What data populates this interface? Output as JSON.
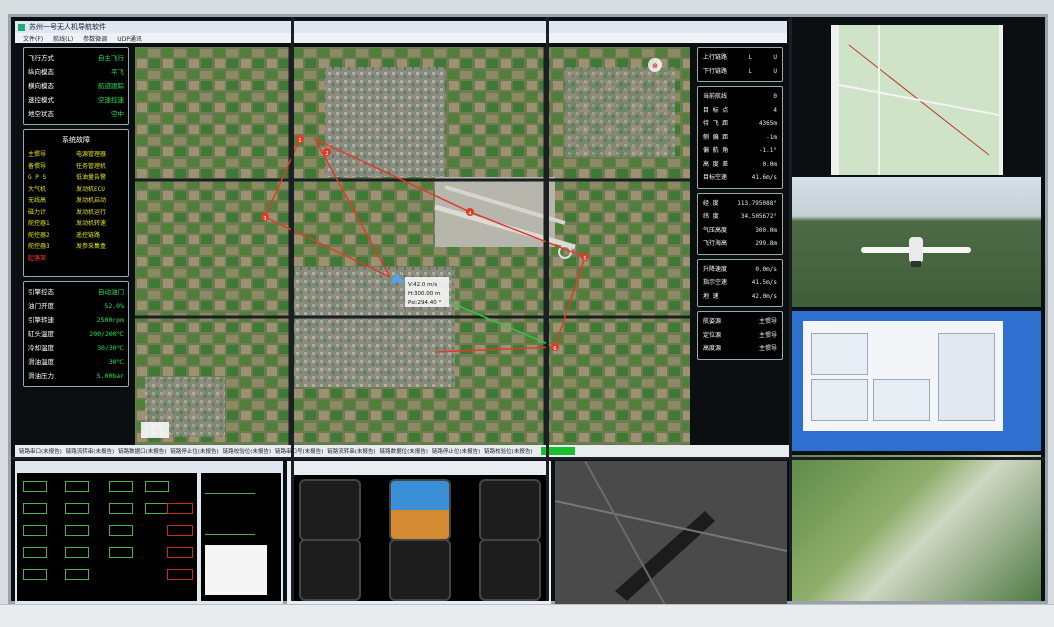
{
  "main_window": {
    "title": "苏州一号无人机导航软件",
    "menu": [
      "文件(F)",
      "航线(L)",
      "参数微调",
      "UDP通讯"
    ]
  },
  "flight_mode": [
    {
      "label": "飞行方式",
      "value": "自主飞行"
    },
    {
      "label": "纵向模态",
      "value": "平飞"
    },
    {
      "label": "横向模态",
      "value": "航迹跟踪"
    },
    {
      "label": "速控模式",
      "value": "空速控速"
    },
    {
      "label": "地空状态",
      "value": "空中"
    }
  ],
  "faults": {
    "title": "系统故障",
    "items": [
      {
        "text": "主惯导",
        "red": false
      },
      {
        "text": "电源管理器",
        "red": false
      },
      {
        "text": "备惯导",
        "red": false
      },
      {
        "text": "任务管理机",
        "red": false
      },
      {
        "text": "G P S",
        "red": false
      },
      {
        "text": "低油量告警",
        "red": false
      },
      {
        "text": "大气机",
        "red": false
      },
      {
        "text": "发动机ECU",
        "red": false
      },
      {
        "text": "无线高",
        "red": false
      },
      {
        "text": "发动机启动",
        "red": false
      },
      {
        "text": "磁力计",
        "red": false
      },
      {
        "text": "发动机运行",
        "red": false
      },
      {
        "text": "舵控器1",
        "red": false
      },
      {
        "text": "发动机转速",
        "red": false
      },
      {
        "text": "舵控器2",
        "red": false
      },
      {
        "text": "遥控链路",
        "red": false
      },
      {
        "text": "舵控器3",
        "red": false
      },
      {
        "text": "发参采集盒",
        "red": false
      },
      {
        "text": "起落架",
        "red": true
      }
    ]
  },
  "engine": [
    {
      "label": "引擎控态",
      "value": "自动油门"
    },
    {
      "label": "油门开度",
      "value": "52.0%"
    },
    {
      "label": "引擎转速",
      "value": "2500rpm"
    },
    {
      "label": "缸头温度",
      "value": "200/200℃"
    },
    {
      "label": "冷却温度",
      "value": "30/30℃"
    },
    {
      "label": "滑油温度",
      "value": "30℃"
    },
    {
      "label": "滑油压力",
      "value": "5.00bar"
    }
  ],
  "links": [
    {
      "label": "上行链路",
      "v1": "L",
      "v2": "U"
    },
    {
      "label": "下行链路",
      "v1": "L",
      "v2": "U"
    }
  ],
  "route": [
    {
      "label": "当前航线",
      "value": "0"
    },
    {
      "label": "目 标 点",
      "value": "4"
    },
    {
      "label": "待 飞 距",
      "value": "4365m"
    },
    {
      "label": "侧 偏 距",
      "value": "-1m"
    },
    {
      "label": "偏 航 角",
      "value": "-1.1°"
    },
    {
      "label": "高 度 差",
      "value": "0.0m"
    },
    {
      "label": "目标空速",
      "value": "41.6m/s"
    }
  ],
  "position": [
    {
      "label": "经   度",
      "value": "113.795088°"
    },
    {
      "label": "纬   度",
      "value": "34.505672°"
    },
    {
      "label": "气压高度",
      "value": "300.0m"
    },
    {
      "label": "飞行海高",
      "value": "299.8m"
    }
  ],
  "speeds": [
    {
      "label": "升降速度",
      "value": "0.0m/s"
    },
    {
      "label": "指示空速",
      "value": "41.5m/s"
    },
    {
      "label": "地    速",
      "value": "42.0m/s"
    }
  ],
  "sources": [
    {
      "label": "航姿源",
      "value": "主惯导"
    },
    {
      "label": "定位源",
      "value": "主惯导"
    },
    {
      "label": "高度源",
      "value": "主惯导"
    }
  ],
  "map_tooltip": {
    "line1": "V:42.0 m/s",
    "line2": "H:300.00 m",
    "line3": "Psi:294.40 °"
  },
  "waypoints": [
    "1",
    "2",
    "3",
    "4",
    "5",
    "6"
  ],
  "status_bar": [
    "链路串口(未报告)",
    "链路流转串(未报告)",
    "链路数据口(未报告)",
    "链路停止位(未报告)",
    "链路校验位(未报告)",
    "链路串口号(未报告)",
    "链路流转串(未报告)",
    "链路数据位(未报告)",
    "链路停止位(未报告)",
    "链路校验位(未报告)"
  ],
  "colors": {
    "green": "#29e24b",
    "yellow": "#e2e21a",
    "red": "#ff3a2a"
  }
}
